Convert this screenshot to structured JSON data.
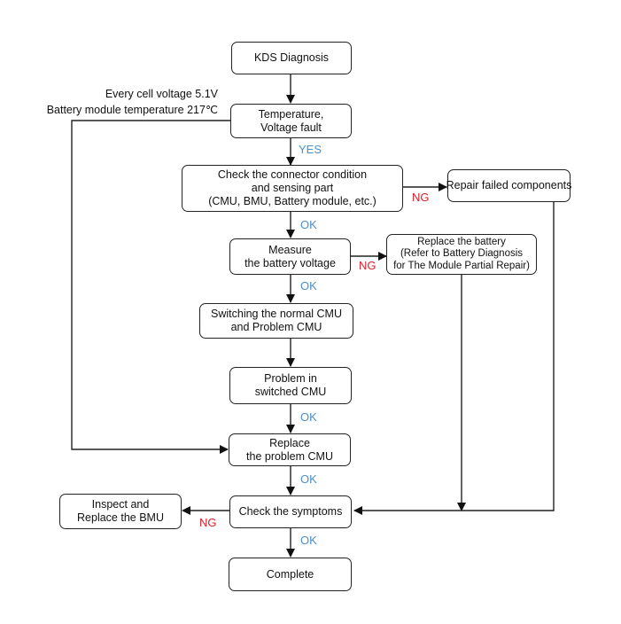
{
  "diagram": {
    "type": "flowchart",
    "colors": {
      "ok_label": "#4a90c8",
      "ng_label": "#e0202a",
      "line": "#222222"
    },
    "condition_note": [
      "Every cell voltage 5.1V",
      "Battery module temperature 217℃"
    ],
    "nodes": {
      "kds": [
        "KDS Diagnosis"
      ],
      "temp_fault": [
        "Temperature,",
        "Voltage fault"
      ],
      "check_connector": [
        "Check the connector condition",
        "and sensing part",
        "(CMU, BMU, Battery module, etc.)"
      ],
      "repair_failed": [
        "Repair failed components"
      ],
      "measure_voltage": [
        "Measure",
        "the battery voltage"
      ],
      "replace_battery": [
        "Replace the battery",
        "(Refer to Battery Diagnosis",
        "for The Module Partial Repair)"
      ],
      "switch_cmu": [
        "Switching the normal CMU",
        "and Problem CMU"
      ],
      "problem_switched": [
        "Problem in",
        "switched CMU"
      ],
      "replace_cmu": [
        "Replace",
        "the problem CMU"
      ],
      "check_symptoms": [
        "Check the symptoms"
      ],
      "inspect_bmu": [
        "Inspect and",
        "Replace the BMU"
      ],
      "complete": [
        "Complete"
      ]
    },
    "edge_labels": {
      "yes": "YES",
      "ok1": "OK",
      "ng1": "NG",
      "ok2": "OK",
      "ng2": "NG",
      "ok3": "OK",
      "ok4": "OK",
      "ng3": "NG",
      "ok5": "OK"
    }
  }
}
